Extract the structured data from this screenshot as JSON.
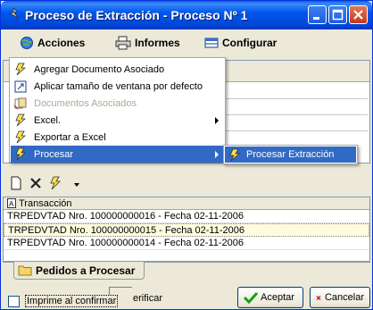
{
  "window": {
    "title": "Proceso de Extracción - Proceso Nº 1"
  },
  "menubar": {
    "items": [
      {
        "label": "Acciones",
        "icon": "globe-icon"
      },
      {
        "label": "Informes",
        "icon": "printer-icon"
      },
      {
        "label": "Configurar",
        "icon": "table-icon"
      }
    ]
  },
  "actions_menu": {
    "items": [
      {
        "label": "Agregar Documento Asociado",
        "icon": "lightning-icon",
        "enabled": true,
        "submenu": false
      },
      {
        "label": "Aplicar tamaño de ventana por defecto",
        "icon": "window-icon",
        "enabled": true,
        "submenu": false
      },
      {
        "label": "Documentos Asociados",
        "icon": "documents-icon",
        "enabled": false,
        "submenu": false
      },
      {
        "label": "Excel.",
        "icon": "lightning-icon",
        "enabled": true,
        "submenu": true
      },
      {
        "label": "Exportar a Excel",
        "icon": "lightning-icon",
        "enabled": true,
        "submenu": false
      },
      {
        "label": "Procesar",
        "icon": "lightning-icon",
        "enabled": true,
        "submenu": true,
        "highlighted": true
      }
    ]
  },
  "submenu": {
    "items": [
      {
        "label": "Procesar Extracción",
        "icon": "lightning-icon"
      }
    ]
  },
  "grid": {
    "header": "Transacción",
    "rows": [
      "TRPEDVTAD Nro.  100000000016 - Fecha 02-11-2006",
      "TRPEDVTAD Nro.  100000000015 - Fecha 02-11-2006",
      "TRPEDVTAD Nro.  100000000014 - Fecha 02-11-2006"
    ]
  },
  "tab": {
    "label": "Pedidos a Procesar"
  },
  "bottom": {
    "checkbox_label": "Imprime al confirmar",
    "verify_label": "erificar",
    "accept_label": "Aceptar",
    "cancel_label": "Cancelar"
  },
  "colors": {
    "titlebar": "#0058ee",
    "highlight": "#316ac5",
    "accept_check": "#1a9c1a",
    "cancel_x": "#c01818"
  }
}
